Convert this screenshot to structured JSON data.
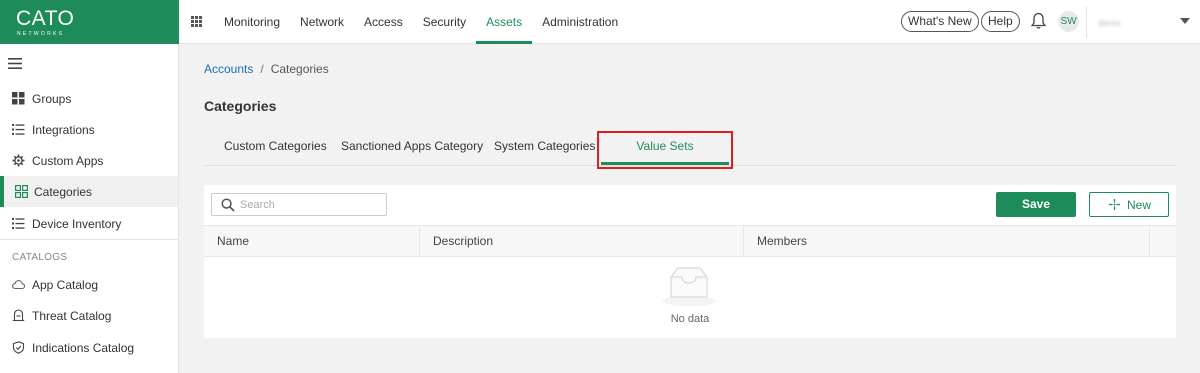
{
  "logo": {
    "main": "CATO",
    "sub": "NETWORKS"
  },
  "nav": {
    "items": [
      {
        "label": "Monitoring"
      },
      {
        "label": "Network"
      },
      {
        "label": "Access"
      },
      {
        "label": "Security"
      },
      {
        "label": "Assets"
      },
      {
        "label": "Administration"
      }
    ],
    "active": "Assets"
  },
  "header": {
    "whats_new": "What's New",
    "help": "Help",
    "avatar_initials": "SW",
    "account_name": "demo"
  },
  "sidebar": {
    "items": [
      {
        "label": "Groups",
        "icon": "grid-icon"
      },
      {
        "label": "Integrations",
        "icon": "list-icon"
      },
      {
        "label": "Custom Apps",
        "icon": "gear-icon"
      },
      {
        "label": "Categories",
        "icon": "categories-icon",
        "active": true
      },
      {
        "label": "Device Inventory",
        "icon": "list-icon"
      }
    ],
    "section_label": "CATALOGS",
    "catalog_items": [
      {
        "label": "App Catalog",
        "icon": "cloud-icon"
      },
      {
        "label": "Threat Catalog",
        "icon": "threat-icon"
      },
      {
        "label": "Indications Catalog",
        "icon": "shield-icon"
      }
    ]
  },
  "breadcrumb": {
    "root": "Accounts",
    "separator": "/",
    "current": "Categories"
  },
  "page": {
    "title": "Categories"
  },
  "tabs": [
    {
      "label": "Custom Categories"
    },
    {
      "label": "Sanctioned Apps Category"
    },
    {
      "label": "System Categories"
    },
    {
      "label": "Value Sets",
      "active": true
    }
  ],
  "toolbar": {
    "search_placeholder": "Search",
    "search_value": "",
    "save_label": "Save",
    "new_label": "New"
  },
  "table": {
    "columns": [
      "Name",
      "Description",
      "Members"
    ],
    "rows": [],
    "empty_text": "No data"
  },
  "colors": {
    "brand": "#1e8c5a",
    "highlight": "#e01e1e",
    "link": "#1a6fb5"
  }
}
